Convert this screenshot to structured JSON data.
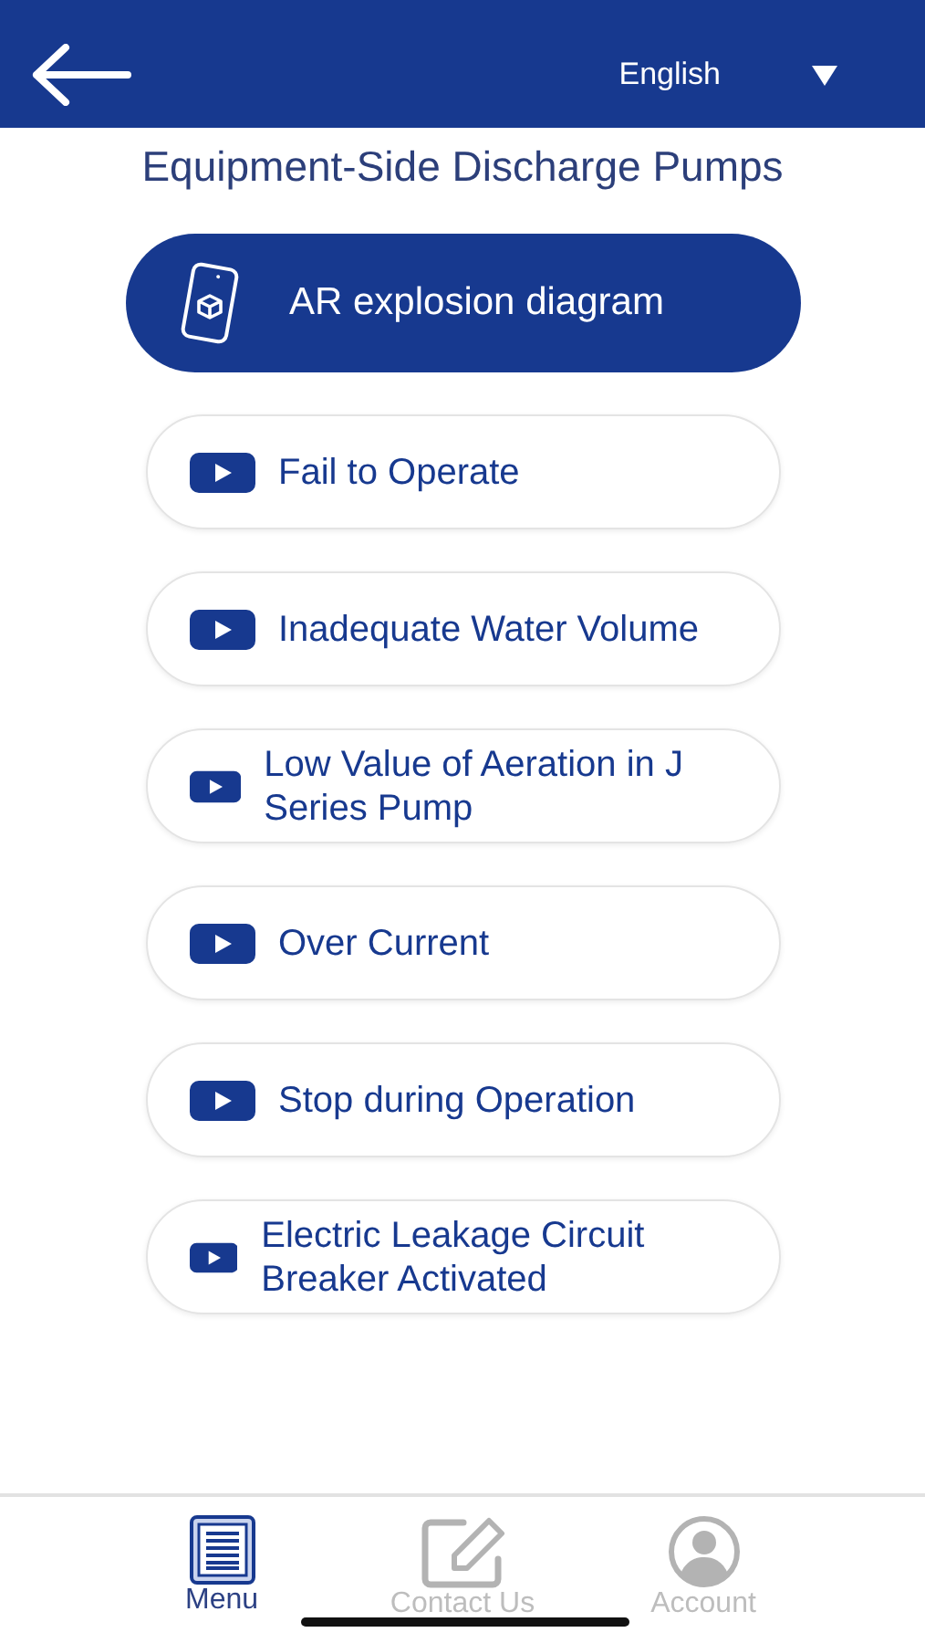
{
  "header": {
    "language": "English"
  },
  "title": "Equipment-Side Discharge Pumps",
  "items": [
    {
      "kind": "ar",
      "label": "AR explosion diagram"
    },
    {
      "kind": "video",
      "label": "Fail to Operate"
    },
    {
      "kind": "video",
      "label": "Inadequate Water Volume"
    },
    {
      "kind": "video",
      "label": "Low Value of Aeration in J Series Pump"
    },
    {
      "kind": "video",
      "label": "Over Current"
    },
    {
      "kind": "video",
      "label": "Stop during Operation"
    },
    {
      "kind": "video",
      "label": "Electric Leakage Circuit Breaker Activated"
    }
  ],
  "tabs": [
    {
      "kind": "menu",
      "label": "Menu",
      "selected": true
    },
    {
      "kind": "contact",
      "label": "Contact Us",
      "selected": false
    },
    {
      "kind": "account",
      "label": "Account",
      "selected": false
    }
  ]
}
